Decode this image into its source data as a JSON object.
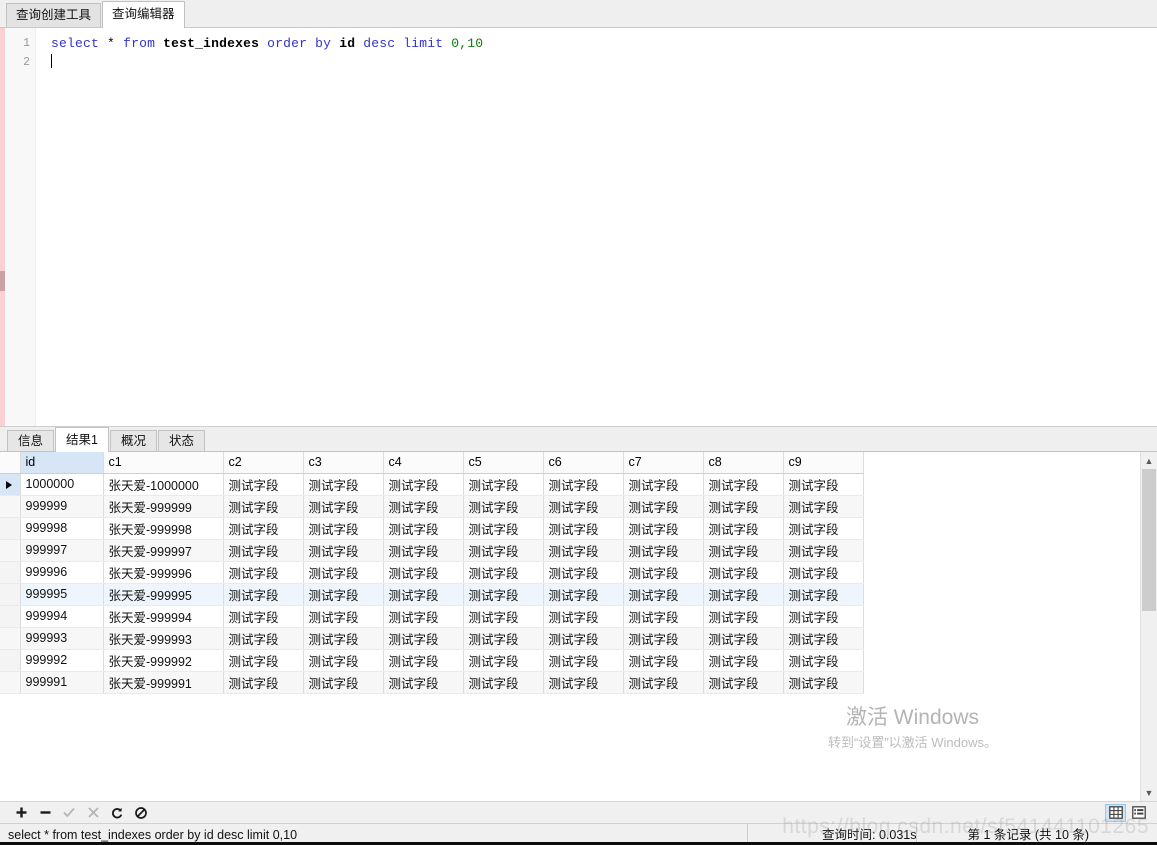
{
  "top_tabs": [
    {
      "label": "查询创建工具",
      "active": false
    },
    {
      "label": "查询编辑器",
      "active": true
    }
  ],
  "editor": {
    "line_numbers": [
      "1",
      "2"
    ],
    "sql_tokens": [
      {
        "text": "select",
        "type": "keyword"
      },
      {
        "text": " ",
        "type": "plain"
      },
      {
        "text": "*",
        "type": "operator"
      },
      {
        "text": " ",
        "type": "plain"
      },
      {
        "text": "from",
        "type": "keyword"
      },
      {
        "text": " ",
        "type": "plain"
      },
      {
        "text": "test_indexes",
        "type": "table"
      },
      {
        "text": " ",
        "type": "plain"
      },
      {
        "text": "order",
        "type": "keyword"
      },
      {
        "text": " ",
        "type": "plain"
      },
      {
        "text": "by",
        "type": "keyword"
      },
      {
        "text": " ",
        "type": "plain"
      },
      {
        "text": "id",
        "type": "table"
      },
      {
        "text": " ",
        "type": "plain"
      },
      {
        "text": "desc",
        "type": "keyword"
      },
      {
        "text": " ",
        "type": "plain"
      },
      {
        "text": "limit",
        "type": "keyword"
      },
      {
        "text": " ",
        "type": "plain"
      },
      {
        "text": "0,10",
        "type": "number"
      }
    ]
  },
  "result_tabs": [
    {
      "label": "信息",
      "active": false
    },
    {
      "label": "结果1",
      "active": true
    },
    {
      "label": "概况",
      "active": false
    },
    {
      "label": "状态",
      "active": false
    }
  ],
  "grid": {
    "columns": [
      "id",
      "c1",
      "c2",
      "c3",
      "c4",
      "c5",
      "c6",
      "c7",
      "c8",
      "c9"
    ],
    "selected_column": "id",
    "current_row_index": 0,
    "highlighted_row_index": 5,
    "rows": [
      {
        "id": "1000000",
        "c1": "张天爱-1000000",
        "c2": "测试字段",
        "c3": "测试字段",
        "c4": "测试字段",
        "c5": "测试字段",
        "c6": "测试字段",
        "c7": "测试字段",
        "c8": "测试字段",
        "c9": "测试字段"
      },
      {
        "id": "999999",
        "c1": "张天爱-999999",
        "c2": "测试字段",
        "c3": "测试字段",
        "c4": "测试字段",
        "c5": "测试字段",
        "c6": "测试字段",
        "c7": "测试字段",
        "c8": "测试字段",
        "c9": "测试字段"
      },
      {
        "id": "999998",
        "c1": "张天爱-999998",
        "c2": "测试字段",
        "c3": "测试字段",
        "c4": "测试字段",
        "c5": "测试字段",
        "c6": "测试字段",
        "c7": "测试字段",
        "c8": "测试字段",
        "c9": "测试字段"
      },
      {
        "id": "999997",
        "c1": "张天爱-999997",
        "c2": "测试字段",
        "c3": "测试字段",
        "c4": "测试字段",
        "c5": "测试字段",
        "c6": "测试字段",
        "c7": "测试字段",
        "c8": "测试字段",
        "c9": "测试字段"
      },
      {
        "id": "999996",
        "c1": "张天爱-999996",
        "c2": "测试字段",
        "c3": "测试字段",
        "c4": "测试字段",
        "c5": "测试字段",
        "c6": "测试字段",
        "c7": "测试字段",
        "c8": "测试字段",
        "c9": "测试字段"
      },
      {
        "id": "999995",
        "c1": "张天爱-999995",
        "c2": "测试字段",
        "c3": "测试字段",
        "c4": "测试字段",
        "c5": "测试字段",
        "c6": "测试字段",
        "c7": "测试字段",
        "c8": "测试字段",
        "c9": "测试字段"
      },
      {
        "id": "999994",
        "c1": "张天爱-999994",
        "c2": "测试字段",
        "c3": "测试字段",
        "c4": "测试字段",
        "c5": "测试字段",
        "c6": "测试字段",
        "c7": "测试字段",
        "c8": "测试字段",
        "c9": "测试字段"
      },
      {
        "id": "999993",
        "c1": "张天爱-999993",
        "c2": "测试字段",
        "c3": "测试字段",
        "c4": "测试字段",
        "c5": "测试字段",
        "c6": "测试字段",
        "c7": "测试字段",
        "c8": "测试字段",
        "c9": "测试字段"
      },
      {
        "id": "999992",
        "c1": "张天爱-999992",
        "c2": "测试字段",
        "c3": "测试字段",
        "c4": "测试字段",
        "c5": "测试字段",
        "c6": "测试字段",
        "c7": "测试字段",
        "c8": "测试字段",
        "c9": "测试字段"
      },
      {
        "id": "999991",
        "c1": "张天爱-999991",
        "c2": "测试字段",
        "c3": "测试字段",
        "c4": "测试字段",
        "c5": "测试字段",
        "c6": "测试字段",
        "c7": "测试字段",
        "c8": "测试字段",
        "c9": "测试字段"
      }
    ]
  },
  "toolbar": {
    "buttons": [
      {
        "name": "add-record-button",
        "glyph": "✚",
        "disabled": false
      },
      {
        "name": "delete-record-button",
        "glyph": "━",
        "disabled": false
      },
      {
        "name": "apply-changes-button",
        "glyph": "✓",
        "disabled": true
      },
      {
        "name": "cancel-changes-button",
        "glyph": "✕",
        "disabled": true
      },
      {
        "name": "refresh-button",
        "glyph": "⟳",
        "disabled": false
      },
      {
        "name": "stop-button",
        "glyph": "⊘",
        "disabled": false
      }
    ],
    "view_grid_label": "grid-view",
    "view_form_label": "form-view"
  },
  "statusbar": {
    "sql": "select * from test_indexes order by id desc limit 0,10",
    "query_time": "查询时间: 0.031s",
    "record_info": "第 1 条记录 (共 10 条)"
  },
  "watermark": {
    "title": "激活 Windows",
    "subtitle": "转到“设置”以激活 Windows。",
    "site": "https://blog.csdn.net/sf541441101265"
  },
  "colors": {
    "keyword": "#3333cc",
    "number": "#0a7d0a",
    "accent": "#d6e6f7",
    "pink_strip": "#fbd0d0"
  }
}
